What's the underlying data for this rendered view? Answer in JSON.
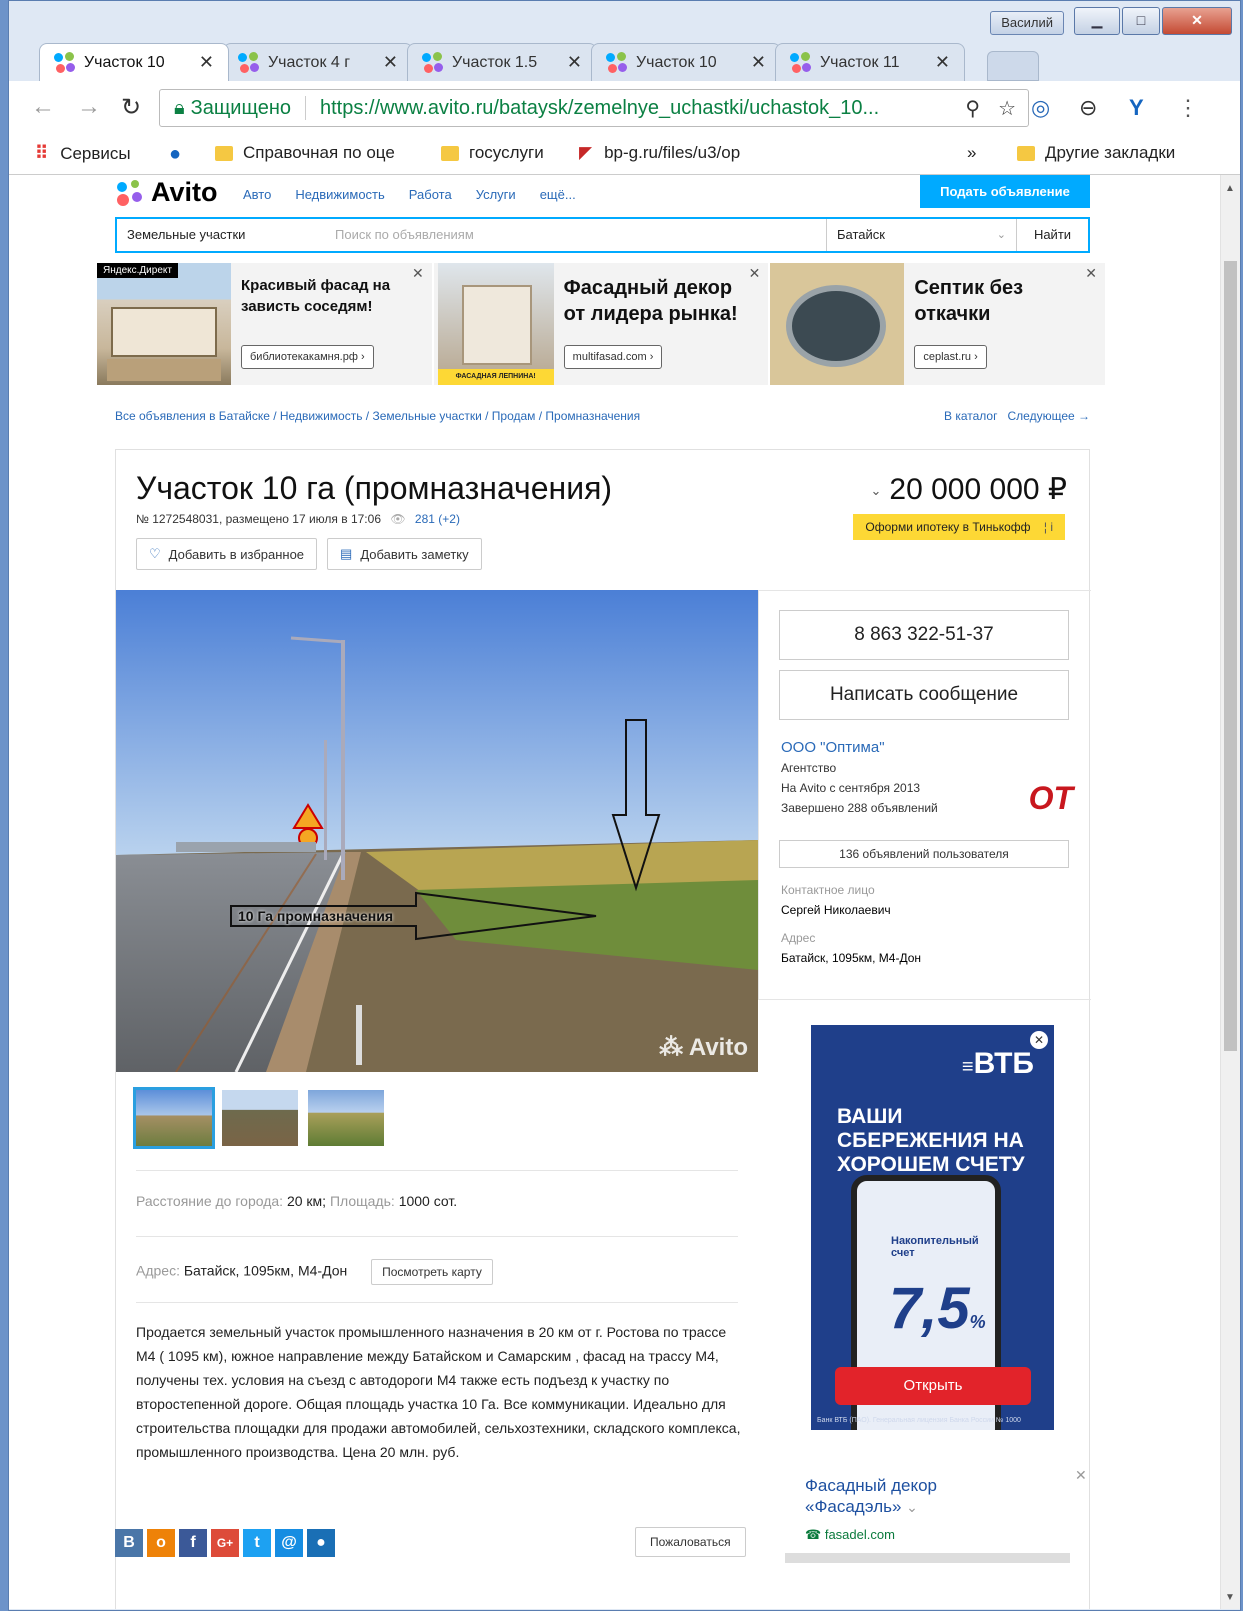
{
  "window": {
    "user": "Василий",
    "minimize": "▁",
    "maximize": "□",
    "close": "✕"
  },
  "tabs": [
    {
      "label": "Участок 10",
      "close": "✕"
    },
    {
      "label": "Участок 4 г",
      "close": "✕"
    },
    {
      "label": "Участок 1.5",
      "close": "✕"
    },
    {
      "label": "Участок 10",
      "close": "✕"
    },
    {
      "label": "Участок 11",
      "close": "✕"
    }
  ],
  "omnibox": {
    "secure": "Защищено",
    "url": "https://www.avito.ru/bataysk/zemelnye_uchastki/uchastok_10..."
  },
  "bookmarks": {
    "apps": "Сервисы",
    "items": [
      "Справочная по оце",
      "госуслуги",
      "bp-g.ru/files/u3/op"
    ],
    "more": "»",
    "other": "Другие закладки"
  },
  "site": {
    "logo": "Avito",
    "nav": [
      "Авто",
      "Недвижимость",
      "Работа",
      "Услуги",
      "ещё..."
    ],
    "post_button": "Подать объявление",
    "search": {
      "category": "Земельные участки",
      "placeholder": "Поиск по объявлениям",
      "city": "Батайск",
      "button": "Найти"
    }
  },
  "ads": [
    {
      "badge": "Яндекс.Директ",
      "headline": "Красивый фасад на зависть соседям!",
      "button": "библиотекакамня.рф ›"
    },
    {
      "headline": "Фасадный декор от лидера рынка!",
      "button": "multifasad.com ›",
      "img_caption": "ФАСАДНАЯ ЛЕПНИНА!"
    },
    {
      "headline": "Септик без откачки",
      "button": "ceplast.ru ›"
    }
  ],
  "breadcrumbs": "Все объявления в Батайске / Недвижимость / Земельные участки / Продам / Промназначения",
  "breadcrumbs_right": {
    "catalog": "В каталог",
    "next": "Следующее →"
  },
  "listing": {
    "title": "Участок 10 га (промназначения)",
    "meta": "№ 1272548031, размещено 17 июля в 17:06",
    "views": "281 (+2)",
    "fav_button": "Добавить в избранное",
    "note_button": "Добавить заметку",
    "price": "20 000 000 ₽",
    "mortgage": "Оформи ипотеку в Тинькофф",
    "photo_label": "10 Га промназначения",
    "watermark": "Avito",
    "distance_label": "Расстояние до города:",
    "distance_value": "20 км;",
    "area_label": "Площадь:",
    "area_value": "1000 сот.",
    "address_label": "Адрес:",
    "address_value": "Батайск, 1095км, М4-Дон",
    "map_button": "Посмотреть карту",
    "description": "Продается земельный участок промышленного назначения в 20 км от г. Ростова по трассе М4 ( 1095 км), южное направление между Батайском и Самарским , фасад на трассу М4, получены тех. условия на съезд с автодороги М4 также есть подъезд к участку по второстепенной дороге. Общая площадь участка 10 Га. Все коммуникации. Идеально для строительства площадки для продажи автомобилей, сельхозтехники, складского комплекса, промышленного производства. Цена 20 млн. руб."
  },
  "seller": {
    "phone": "8 863 322-51-37",
    "message_button": "Написать сообщение",
    "name": "ООО \"Оптима\"",
    "type": "Агентство",
    "since": "На Avito с сентября 2013",
    "completed": "Завершено 288 объявлений",
    "user_ads": "136 объявлений пользователя",
    "contact_label": "Контактное лицо",
    "contact_name": "Сергей Николаевич",
    "address_label": "Адрес",
    "address": "Батайск, 1095км, М4-Дон",
    "logo_text": "ОТ"
  },
  "vtb_ad": {
    "brand": "ВТБ",
    "headline": "ВАШИ СБЕРЕЖЕНИЯ НА ХОРОШЕМ СЧЕТУ",
    "account": "Накопительный счет",
    "rate": "7,5",
    "rate_unit": "%",
    "button": "Открыть",
    "fine_print": "Банк ВТБ (ПАО). Генеральная лицензия Банка России № 1000"
  },
  "side_ad": {
    "headline": "Фасадный декор «Фасадэль»",
    "url": "fasadel.com"
  },
  "social": [
    "В",
    "о",
    "f",
    "G+",
    "t",
    "@",
    "●"
  ],
  "complain_button": "Пожаловаться",
  "colors": {
    "accent": "#00aaff",
    "link": "#2a6ab8",
    "mortgage": "#fdd835",
    "vtb_blue": "#1f3f8a",
    "vtb_red": "#e2232a"
  }
}
